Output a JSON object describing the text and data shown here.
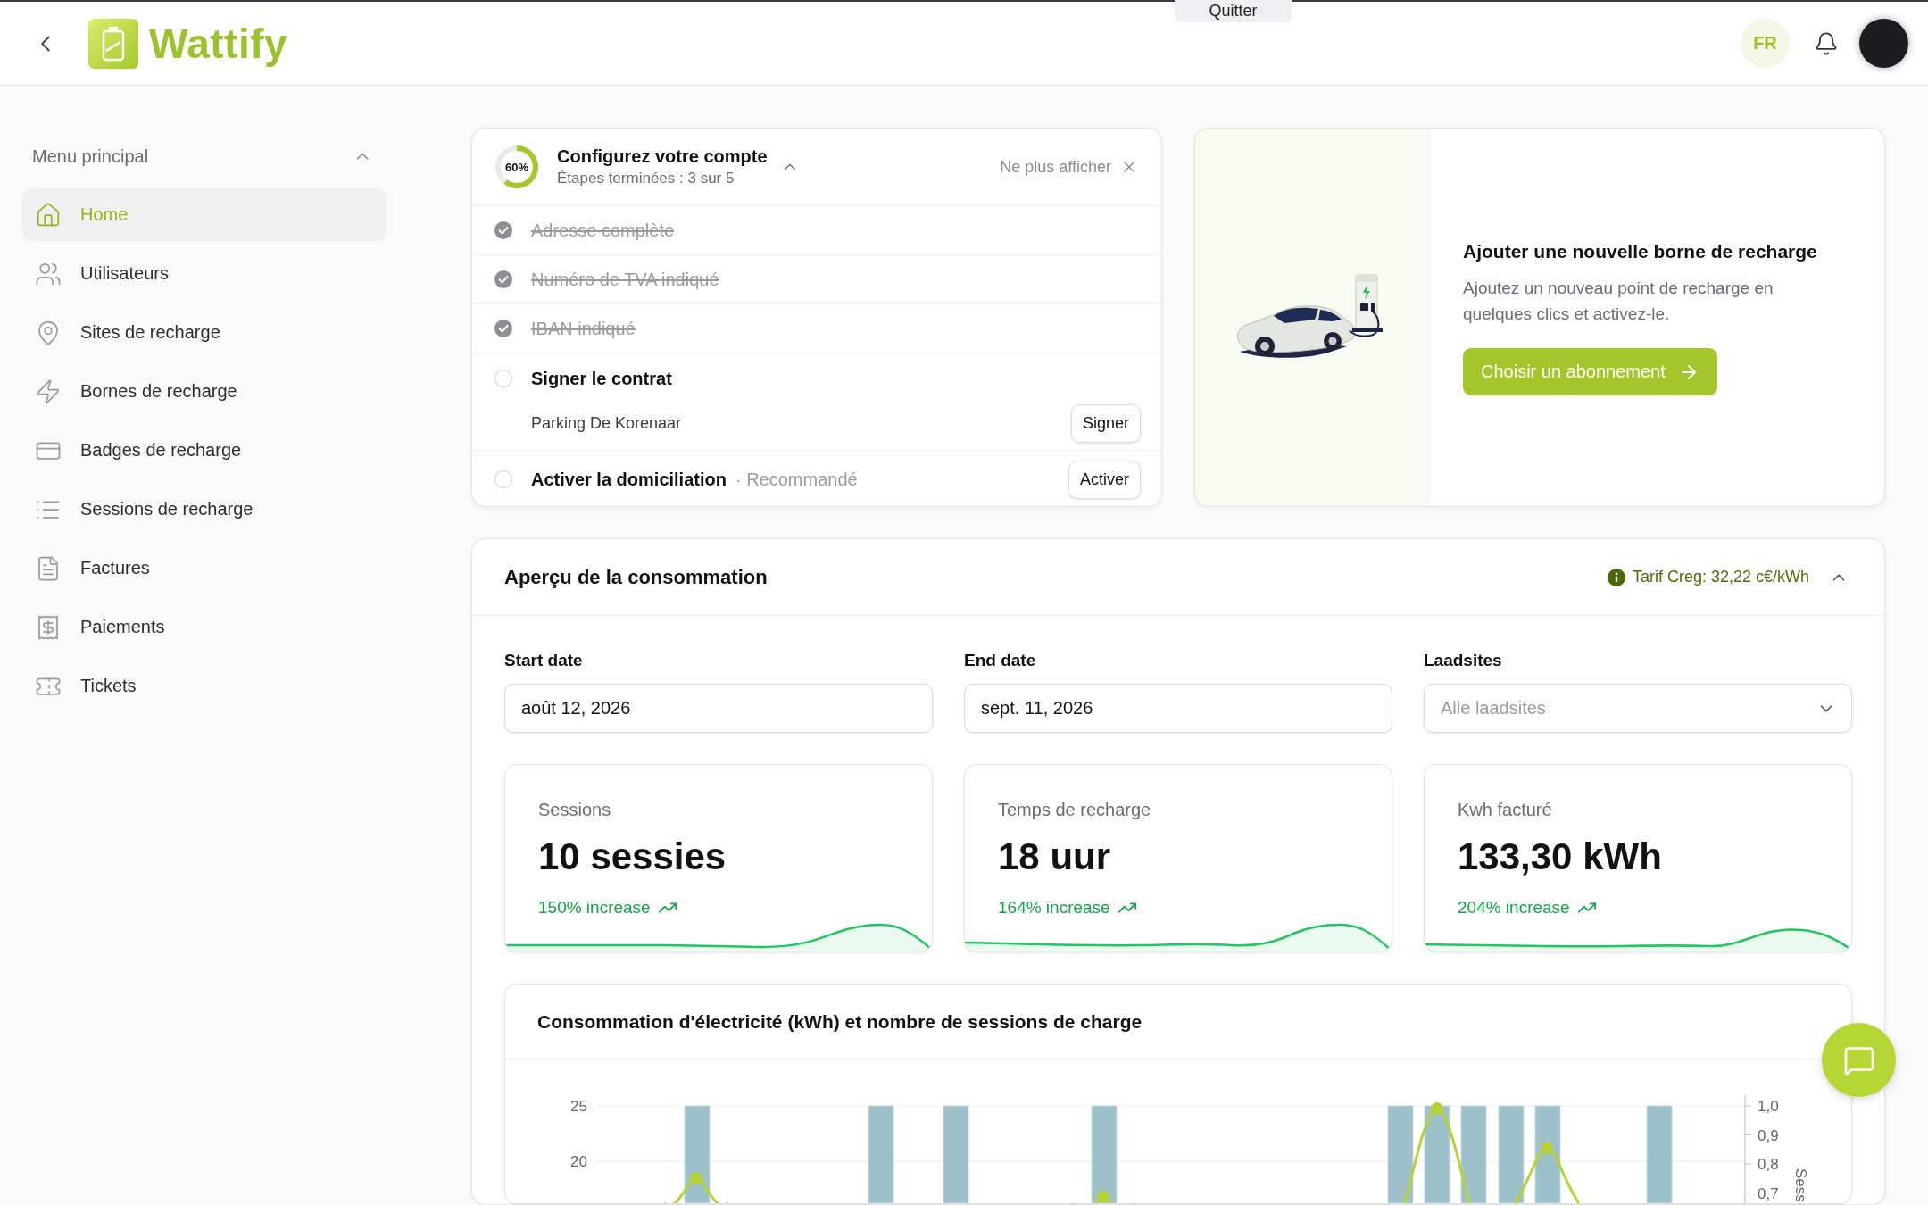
{
  "top_bar": {
    "logo": "Wattify",
    "banner_button": "Quitter",
    "language": "FR"
  },
  "sidebar": {
    "title": "Menu principal",
    "expanded": true,
    "items": [
      {
        "label": "Home",
        "selected": true
      },
      {
        "label": "Utilisateurs",
        "selected": false
      },
      {
        "label": "Sites de recharge",
        "selected": false
      },
      {
        "label": "Bornes de recharge",
        "selected": false
      },
      {
        "label": "Badges de recharge",
        "selected": false
      },
      {
        "label": "Sessions de recharge",
        "selected": false
      },
      {
        "label": "Factures",
        "selected": false
      },
      {
        "label": "Paiements",
        "selected": false
      },
      {
        "label": "Tickets",
        "selected": false
      }
    ]
  },
  "setup": {
    "progress": "60%",
    "level": 0.6,
    "title": "Configurez votre compte",
    "subtitle": "Étapes terminées : 3 sur 5",
    "expanded": true,
    "dismiss": "Ne plus afficher",
    "steps": [
      {
        "label": "Adresse complète",
        "checked": true
      },
      {
        "label": "Numéro de TVA indiqué",
        "checked": true
      },
      {
        "label": "IBAN indiqué",
        "checked": true
      },
      {
        "label": "Signer le contrat",
        "checked": false,
        "detail": "Parking De Korenaar",
        "action": "Signer"
      },
      {
        "label": "Activer la domiciliation",
        "checked": false,
        "note": "· Recommandé",
        "action": "Activer"
      }
    ]
  },
  "promo": {
    "title": "Ajouter une nouvelle borne de recharge",
    "text": "Ajoutez un nouveau point de recharge en quelques clics et activez-le.",
    "button": "Choisir un abonnement"
  },
  "consumption": {
    "title": "Aperçu de la consommation",
    "tariff": "Tarif Creg: 32,22 c€/kWh",
    "expanded": true,
    "filters": [
      {
        "label": "Start date",
        "kind": "date",
        "value": "août 12, 2026"
      },
      {
        "label": "End date",
        "kind": "date",
        "value": "sept. 11, 2026"
      },
      {
        "label": "Laadsites",
        "kind": "select",
        "placeholder": "Alle laadsites"
      }
    ],
    "stats": [
      {
        "label": "Sessions",
        "value": "10 sessies",
        "change": "150% increase"
      },
      {
        "label": "Temps de recharge",
        "value": "18 uur",
        "change": "164% increase"
      },
      {
        "label": "Kwh facturé",
        "value": "133,30 kWh",
        "change": "204% increase"
      }
    ],
    "chart": {
      "title": "Consommation d'électricité (kWh) et nombre de sessions de charge",
      "left_ticks": [
        "25",
        "20"
      ],
      "right_ticks": [
        "1,0",
        "0,9",
        "0,8",
        "0,7"
      ],
      "right_axis_title": "Sess"
    }
  }
}
